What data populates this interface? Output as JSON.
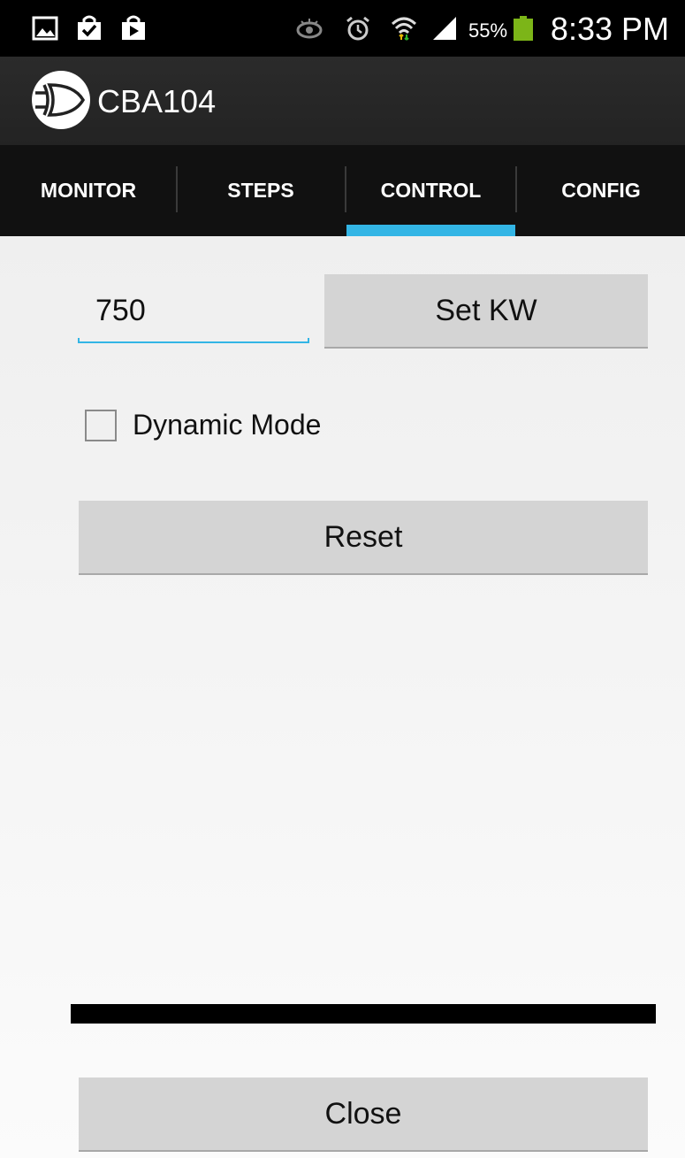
{
  "status_bar": {
    "icons": [
      "gallery-icon",
      "shopping-bag-check-icon",
      "play-store-icon",
      "eye-icon",
      "alarm-clock-icon",
      "wifi-icon",
      "signal-icon",
      "battery-icon"
    ],
    "battery_percent": "55%",
    "time": "8:33 PM",
    "battery_color": "#7cb518"
  },
  "action_bar": {
    "title": "CBA104",
    "logo_icon": "gate-logo-icon"
  },
  "tabs": [
    {
      "label": "MONITOR",
      "selected": false
    },
    {
      "label": "STEPS",
      "selected": false
    },
    {
      "label": "CONTROL",
      "selected": true
    },
    {
      "label": "CONFIG",
      "selected": false
    }
  ],
  "accent_color": "#33b5e5",
  "control": {
    "kw_value": "750",
    "set_kw_label": "Set KW",
    "dynamic_mode_label": "Dynamic Mode",
    "dynamic_mode_checked": false,
    "reset_label": "Reset",
    "close_label": "Close"
  }
}
